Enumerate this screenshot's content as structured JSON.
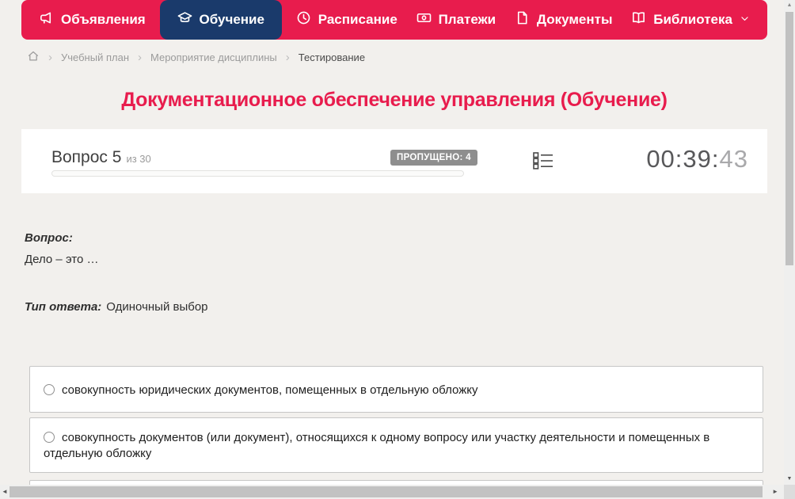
{
  "colors": {
    "accent_red": "#e81c4d",
    "active_tab_navy": "#1a3a6b",
    "page_background": "#f2f0ed",
    "badge_gray": "#8e8e8e"
  },
  "nav": {
    "items": [
      {
        "label": "Объявления",
        "icon": "megaphone-icon",
        "active": false
      },
      {
        "label": "Обучение",
        "icon": "graduation-cap-icon",
        "active": true
      },
      {
        "label": "Расписание",
        "icon": "clock-icon",
        "active": false
      },
      {
        "label": "Платежи",
        "icon": "banknote-icon",
        "active": false
      },
      {
        "label": "Документы",
        "icon": "document-icon",
        "active": false
      },
      {
        "label": "Библиотека",
        "icon": "open-book-icon",
        "active": false,
        "has_dropdown": true
      }
    ]
  },
  "breadcrumb": {
    "separator": "›",
    "items": [
      "Учебный план",
      "Мероприятие дисциплины",
      "Тестирование"
    ]
  },
  "page": {
    "title": "Документационное обеспечение управления (Обучение)"
  },
  "quiz_panel": {
    "question_number": "Вопрос 5",
    "question_total": "из 30",
    "skipped_badge": "ПРОПУЩЕНО: 4",
    "progress_percent": 0,
    "timer_main": "00:39:",
    "timer_seconds": "43"
  },
  "question": {
    "label": "Вопрос:",
    "text": "Дело – это …",
    "type_label": "Тип ответа:",
    "type_value": "Одиночный выбор"
  },
  "options": [
    {
      "text": "совокупность юридических документов, помещенных в отдельную обложку",
      "selected": false
    },
    {
      "text": "совокупность документов (или документ), относящихся к одному вопросу или участку деятельности и помещенных в отдельную обложку",
      "selected": false
    },
    {
      "text": "",
      "selected": false
    }
  ],
  "scrollbars": {
    "up_arrow": "▲",
    "down_arrow": "▼",
    "left_arrow": "◄",
    "right_arrow": "►"
  }
}
